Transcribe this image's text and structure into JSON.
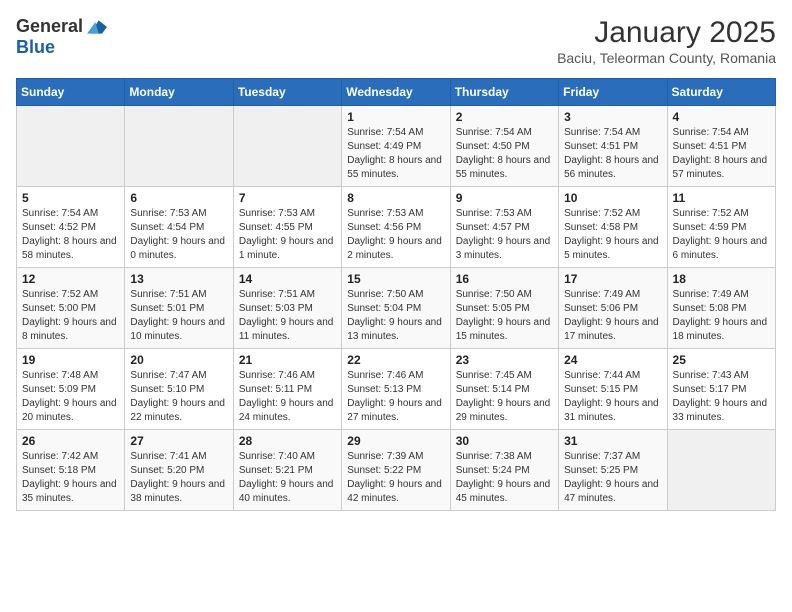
{
  "header": {
    "logo": {
      "general": "General",
      "blue": "Blue"
    },
    "title": "January 2025",
    "location": "Baciu, Teleorman County, Romania"
  },
  "weekdays": [
    "Sunday",
    "Monday",
    "Tuesday",
    "Wednesday",
    "Thursday",
    "Friday",
    "Saturday"
  ],
  "weeks": [
    [
      {
        "day": null,
        "sunrise": null,
        "sunset": null,
        "daylight": null
      },
      {
        "day": null,
        "sunrise": null,
        "sunset": null,
        "daylight": null
      },
      {
        "day": null,
        "sunrise": null,
        "sunset": null,
        "daylight": null
      },
      {
        "day": "1",
        "sunrise": "7:54 AM",
        "sunset": "4:49 PM",
        "daylight": "8 hours and 55 minutes."
      },
      {
        "day": "2",
        "sunrise": "7:54 AM",
        "sunset": "4:50 PM",
        "daylight": "8 hours and 55 minutes."
      },
      {
        "day": "3",
        "sunrise": "7:54 AM",
        "sunset": "4:51 PM",
        "daylight": "8 hours and 56 minutes."
      },
      {
        "day": "4",
        "sunrise": "7:54 AM",
        "sunset": "4:51 PM",
        "daylight": "8 hours and 57 minutes."
      }
    ],
    [
      {
        "day": "5",
        "sunrise": "7:54 AM",
        "sunset": "4:52 PM",
        "daylight": "8 hours and 58 minutes."
      },
      {
        "day": "6",
        "sunrise": "7:53 AM",
        "sunset": "4:54 PM",
        "daylight": "9 hours and 0 minutes."
      },
      {
        "day": "7",
        "sunrise": "7:53 AM",
        "sunset": "4:55 PM",
        "daylight": "9 hours and 1 minute."
      },
      {
        "day": "8",
        "sunrise": "7:53 AM",
        "sunset": "4:56 PM",
        "daylight": "9 hours and 2 minutes."
      },
      {
        "day": "9",
        "sunrise": "7:53 AM",
        "sunset": "4:57 PM",
        "daylight": "9 hours and 3 minutes."
      },
      {
        "day": "10",
        "sunrise": "7:52 AM",
        "sunset": "4:58 PM",
        "daylight": "9 hours and 5 minutes."
      },
      {
        "day": "11",
        "sunrise": "7:52 AM",
        "sunset": "4:59 PM",
        "daylight": "9 hours and 6 minutes."
      }
    ],
    [
      {
        "day": "12",
        "sunrise": "7:52 AM",
        "sunset": "5:00 PM",
        "daylight": "9 hours and 8 minutes."
      },
      {
        "day": "13",
        "sunrise": "7:51 AM",
        "sunset": "5:01 PM",
        "daylight": "9 hours and 10 minutes."
      },
      {
        "day": "14",
        "sunrise": "7:51 AM",
        "sunset": "5:03 PM",
        "daylight": "9 hours and 11 minutes."
      },
      {
        "day": "15",
        "sunrise": "7:50 AM",
        "sunset": "5:04 PM",
        "daylight": "9 hours and 13 minutes."
      },
      {
        "day": "16",
        "sunrise": "7:50 AM",
        "sunset": "5:05 PM",
        "daylight": "9 hours and 15 minutes."
      },
      {
        "day": "17",
        "sunrise": "7:49 AM",
        "sunset": "5:06 PM",
        "daylight": "9 hours and 17 minutes."
      },
      {
        "day": "18",
        "sunrise": "7:49 AM",
        "sunset": "5:08 PM",
        "daylight": "9 hours and 18 minutes."
      }
    ],
    [
      {
        "day": "19",
        "sunrise": "7:48 AM",
        "sunset": "5:09 PM",
        "daylight": "9 hours and 20 minutes."
      },
      {
        "day": "20",
        "sunrise": "7:47 AM",
        "sunset": "5:10 PM",
        "daylight": "9 hours and 22 minutes."
      },
      {
        "day": "21",
        "sunrise": "7:46 AM",
        "sunset": "5:11 PM",
        "daylight": "9 hours and 24 minutes."
      },
      {
        "day": "22",
        "sunrise": "7:46 AM",
        "sunset": "5:13 PM",
        "daylight": "9 hours and 27 minutes."
      },
      {
        "day": "23",
        "sunrise": "7:45 AM",
        "sunset": "5:14 PM",
        "daylight": "9 hours and 29 minutes."
      },
      {
        "day": "24",
        "sunrise": "7:44 AM",
        "sunset": "5:15 PM",
        "daylight": "9 hours and 31 minutes."
      },
      {
        "day": "25",
        "sunrise": "7:43 AM",
        "sunset": "5:17 PM",
        "daylight": "9 hours and 33 minutes."
      }
    ],
    [
      {
        "day": "26",
        "sunrise": "7:42 AM",
        "sunset": "5:18 PM",
        "daylight": "9 hours and 35 minutes."
      },
      {
        "day": "27",
        "sunrise": "7:41 AM",
        "sunset": "5:20 PM",
        "daylight": "9 hours and 38 minutes."
      },
      {
        "day": "28",
        "sunrise": "7:40 AM",
        "sunset": "5:21 PM",
        "daylight": "9 hours and 40 minutes."
      },
      {
        "day": "29",
        "sunrise": "7:39 AM",
        "sunset": "5:22 PM",
        "daylight": "9 hours and 42 minutes."
      },
      {
        "day": "30",
        "sunrise": "7:38 AM",
        "sunset": "5:24 PM",
        "daylight": "9 hours and 45 minutes."
      },
      {
        "day": "31",
        "sunrise": "7:37 AM",
        "sunset": "5:25 PM",
        "daylight": "9 hours and 47 minutes."
      },
      {
        "day": null,
        "sunrise": null,
        "sunset": null,
        "daylight": null
      }
    ]
  ]
}
